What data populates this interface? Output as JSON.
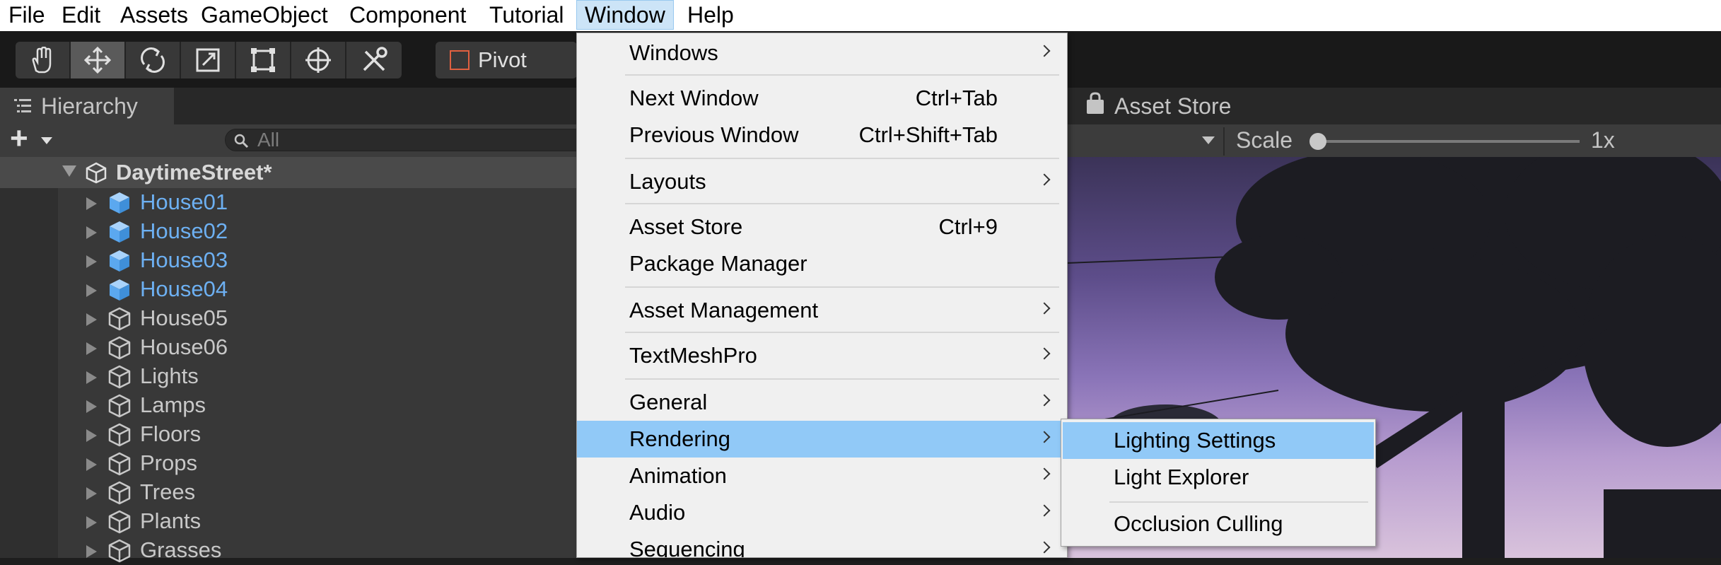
{
  "menubar": {
    "items": [
      "File",
      "Edit",
      "Assets",
      "GameObject",
      "Component",
      "Tutorial",
      "Window",
      "Help"
    ],
    "active": "Window"
  },
  "toolbar": {
    "tools": [
      "hand-tool",
      "move-tool",
      "rotate-tool",
      "scale-tool",
      "rect-tool",
      "transform-tool",
      "custom-tool"
    ],
    "selected_tool": "move-tool",
    "pivot_label": "Pivot"
  },
  "hierarchy": {
    "tab_label": "Hierarchy",
    "add_label": "+",
    "search_placeholder": "All",
    "scene_name": "DaytimeStreet*",
    "items": [
      {
        "label": "House01",
        "prefab": true
      },
      {
        "label": "House02",
        "prefab": true
      },
      {
        "label": "House03",
        "prefab": true
      },
      {
        "label": "House04",
        "prefab": true
      },
      {
        "label": "House05",
        "prefab": false
      },
      {
        "label": "House06",
        "prefab": false
      },
      {
        "label": "Lights",
        "prefab": false
      },
      {
        "label": "Lamps",
        "prefab": false
      },
      {
        "label": "Floors",
        "prefab": false
      },
      {
        "label": "Props",
        "prefab": false
      },
      {
        "label": "Trees",
        "prefab": false
      },
      {
        "label": "Plants",
        "prefab": false
      },
      {
        "label": "Grasses",
        "prefab": false
      }
    ]
  },
  "game": {
    "asset_tab_label": "Asset Store",
    "scale_label": "Scale",
    "scale_value": "1x"
  },
  "window_menu": {
    "items": [
      {
        "label": "Windows",
        "shortcut": "",
        "submenu": true
      },
      {
        "label": "Next Window",
        "shortcut": "Ctrl+Tab",
        "submenu": false
      },
      {
        "label": "Previous Window",
        "shortcut": "Ctrl+Shift+Tab",
        "submenu": false
      },
      {
        "label": "Layouts",
        "shortcut": "",
        "submenu": true
      },
      {
        "label": "Asset Store",
        "shortcut": "Ctrl+9",
        "submenu": false
      },
      {
        "label": "Package Manager",
        "shortcut": "",
        "submenu": false
      },
      {
        "label": "Asset Management",
        "shortcut": "",
        "submenu": true
      },
      {
        "label": "TextMeshPro",
        "shortcut": "",
        "submenu": true
      },
      {
        "label": "General",
        "shortcut": "",
        "submenu": true
      },
      {
        "label": "Rendering",
        "shortcut": "",
        "submenu": true
      },
      {
        "label": "Animation",
        "shortcut": "",
        "submenu": true
      },
      {
        "label": "Audio",
        "shortcut": "",
        "submenu": true
      },
      {
        "label": "Sequencing",
        "shortcut": "",
        "submenu": true
      }
    ],
    "highlighted": "Rendering"
  },
  "rendering_submenu": {
    "items": [
      "Lighting Settings",
      "Light Explorer",
      "Occlusion Culling"
    ],
    "highlighted": "Lighting Settings"
  },
  "colors": {
    "menu_highlight": "#91c9f7",
    "prefab_blue": "#6db0f2",
    "editor_dark": "#383838"
  }
}
